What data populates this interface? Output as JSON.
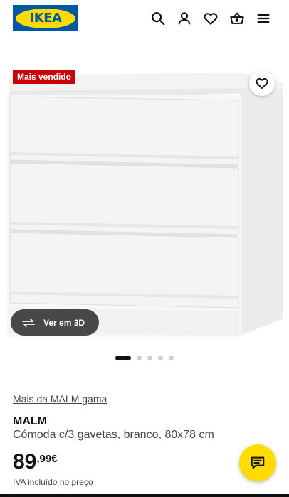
{
  "header": {
    "logo_text": "IKEA",
    "icons": [
      "search-icon",
      "account-icon",
      "heart-icon",
      "basket-icon",
      "menu-icon"
    ]
  },
  "gallery": {
    "badge": "Mais vendido",
    "view_3d_label": "Ver em 3D",
    "slide_count": 5,
    "active_slide": 1
  },
  "product": {
    "range_link": "Mais da MALM gama",
    "name": "MALM",
    "description": "Cómoda c/3 gavetas, branco, ",
    "dimensions": "80x78 cm",
    "price_integer": "89",
    "price_decimal": ",99€",
    "vat_note": "IVA incluído no preço"
  },
  "colors": {
    "brand_blue": "#0058a3",
    "brand_yellow": "#ffdb00",
    "badge_red": "#cc0008"
  }
}
